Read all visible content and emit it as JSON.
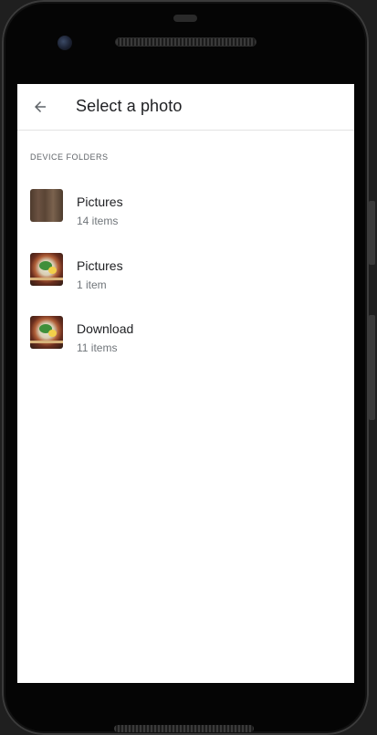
{
  "header": {
    "title": "Select a photo"
  },
  "section": {
    "title": "DEVICE FOLDERS"
  },
  "folders": [
    {
      "name": "Pictures",
      "count": "14 items",
      "thumbnail": "wood-texture"
    },
    {
      "name": "Pictures",
      "count": "1 item",
      "thumbnail": "ramen-bowl"
    },
    {
      "name": "Download",
      "count": "11 items",
      "thumbnail": "ramen-bowl"
    }
  ],
  "icons": {
    "back": "arrow-back-icon"
  },
  "colors": {
    "title_text": "#202124",
    "secondary_text": "#70757a",
    "divider": "#e3e3e3",
    "screen_bg": "#ffffff"
  }
}
